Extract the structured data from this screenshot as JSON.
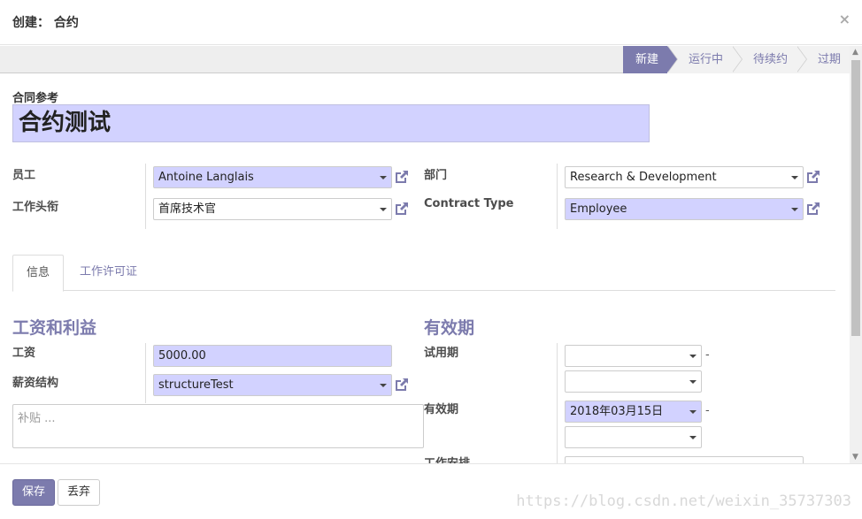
{
  "dialog": {
    "title": "创建： 合约",
    "close_label": "×"
  },
  "status": {
    "stages": [
      "新建",
      "运行中",
      "待续约",
      "过期"
    ],
    "active_stage": "新建"
  },
  "form": {
    "ref_label": "合同参考",
    "ref_value": "合约测试",
    "employee_label": "员工",
    "employee_value": "Antoine Langlais",
    "job_label": "工作头衔",
    "job_value": "首席技术官",
    "department_label": "部门",
    "department_value": "Research & Development",
    "contract_type_label": "Contract Type",
    "contract_type_value": "Employee"
  },
  "tabs": [
    "信息",
    "工作许可证"
  ],
  "salary_section": {
    "title": "工资和利益",
    "wage_label": "工资",
    "wage_value": "5000.00",
    "structure_label": "薪资结构",
    "structure_value": "structureTest",
    "advantages_placeholder": "补贴 ..."
  },
  "duration_section": {
    "title": "有效期",
    "trial_label": "试用期",
    "trial_start": "",
    "trial_end": "",
    "duration_label": "有效期",
    "duration_start": "2018年03月15日",
    "duration_end": "",
    "schedule_label": "工作安排",
    "range_separator": "-"
  },
  "footer": {
    "save_label": "保存",
    "discard_label": "丢弃"
  },
  "watermark": "https://blog.csdn.net/weixin_35737303",
  "colors": {
    "accent": "#7c7bad",
    "required_bg": "#d2d2ff"
  }
}
